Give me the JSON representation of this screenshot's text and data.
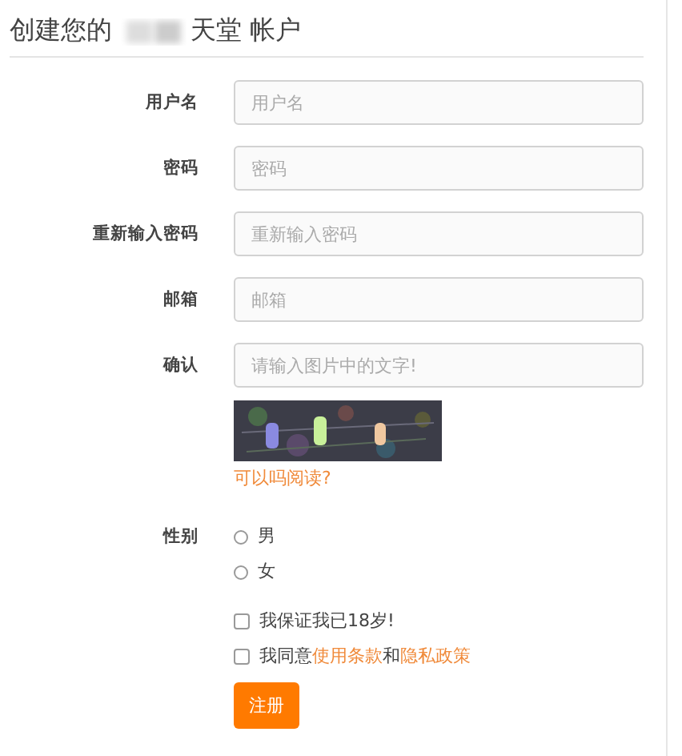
{
  "title": {
    "before": "创建您的",
    "after": "天堂 帐户"
  },
  "fields": [
    {
      "label": "用户名",
      "placeholder": "用户名"
    },
    {
      "label": "密码",
      "placeholder": "密码"
    },
    {
      "label": "重新输入密码",
      "placeholder": "重新输入密码"
    },
    {
      "label": "邮箱",
      "placeholder": "邮箱"
    },
    {
      "label": "确认",
      "placeholder": "请输入图片中的文字!"
    }
  ],
  "captcha": {
    "kind": "picture",
    "link": "可以吗阅读?"
  },
  "gender": {
    "label": "性别",
    "options": [
      {
        "label": "男",
        "selected": false
      },
      {
        "label": "女",
        "selected": false
      }
    ]
  },
  "agreements": [
    {
      "checked": false,
      "parts": [
        {
          "kind": "text",
          "text": "我保证我已18岁!"
        }
      ]
    },
    {
      "checked": false,
      "parts": [
        {
          "kind": "text",
          "text": "我同意"
        },
        {
          "kind": "link",
          "text": "使用条款"
        },
        {
          "kind": "text",
          "text": "和"
        },
        {
          "kind": "link",
          "text": "隐私政策"
        }
      ]
    }
  ],
  "submit": "注册"
}
